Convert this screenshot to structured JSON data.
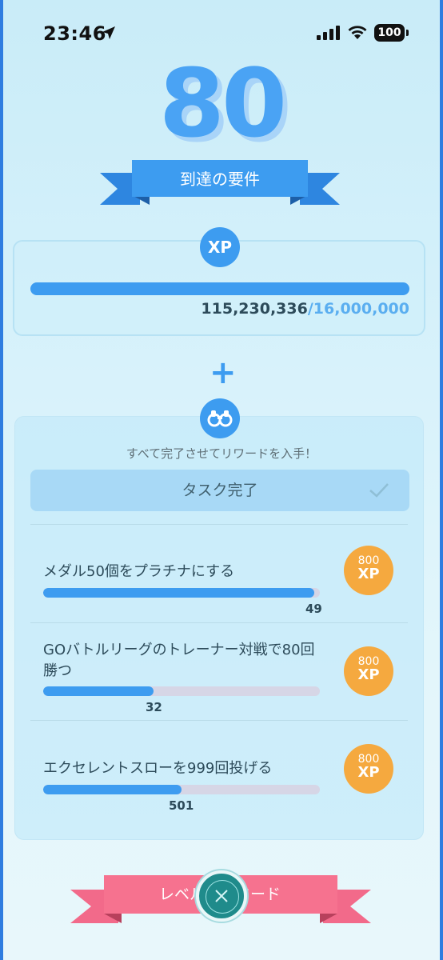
{
  "status_bar": {
    "time": "23:46",
    "battery": "100"
  },
  "level": "80",
  "requirements_banner": "到達の要件",
  "xp": {
    "badge": "XP",
    "current": "115,230,336",
    "separator": "/",
    "total": "16,000,000",
    "progress_fraction": 1.0
  },
  "plus": "+",
  "tasks": {
    "subtitle": "すべて完了させてリワードを入手！",
    "complete_button": "タスク完了",
    "items": [
      {
        "title": "メダル50個をプラチナにする",
        "value": "49",
        "progress_fraction": 0.98,
        "reward_top": "800",
        "reward_bottom": "XP"
      },
      {
        "title": "GOバトルリーグのトレーナー対戦で80回勝つ",
        "value": "32",
        "progress_fraction": 0.4,
        "reward_top": "800",
        "reward_bottom": "XP"
      },
      {
        "title": "エクセレントスローを999回投げる",
        "value": "501",
        "progress_fraction": 0.5,
        "reward_top": "800",
        "reward_bottom": "XP"
      }
    ]
  },
  "bottom_banner": "レベル　リワード",
  "colors": {
    "accent_blue": "#3d9cf0",
    "reward_orange": "#f5a93f",
    "pink_ribbon": "#f26a8a",
    "close_teal": "#1f8b8b"
  }
}
